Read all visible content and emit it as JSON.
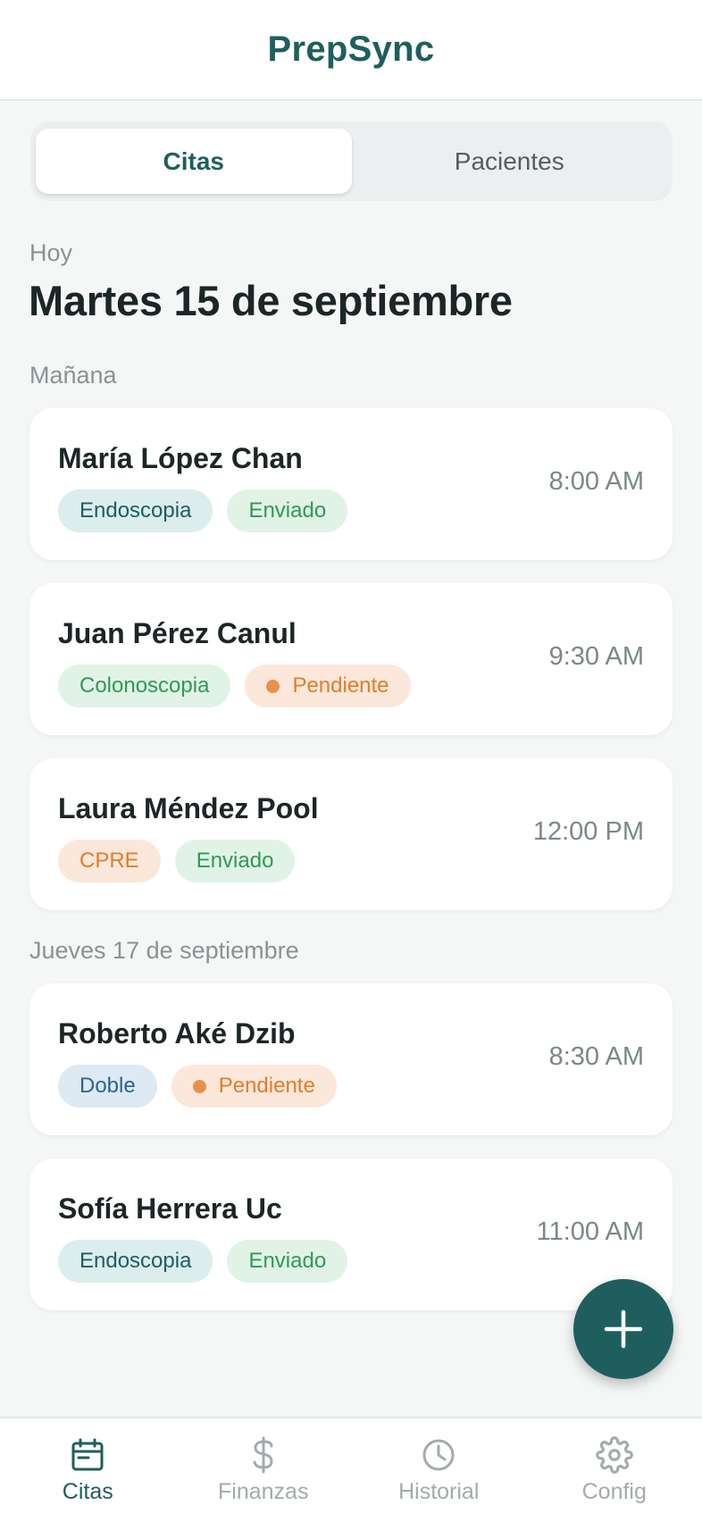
{
  "header": {
    "title": "PrepSync"
  },
  "tabs": [
    {
      "label": "Citas",
      "active": true
    },
    {
      "label": "Pacientes",
      "active": false
    }
  ],
  "today": {
    "label": "Hoy",
    "date": "Martes 15 de septiembre"
  },
  "sections": [
    {
      "label": "Mañana"
    },
    {
      "label": "Jueves 17 de septiembre"
    }
  ],
  "appointments": [
    {
      "name": "María López Chan",
      "time": "8:00 AM",
      "procedure": "Endoscopia",
      "status": "Enviado"
    },
    {
      "name": "Juan Pérez Canul",
      "time": "9:30 AM",
      "procedure": "Colonoscopia",
      "status": "Pendiente"
    },
    {
      "name": "Laura Méndez Pool",
      "time": "12:00 PM",
      "procedure": "CPRE",
      "status": "Enviado"
    },
    {
      "name": "Roberto Aké Dzib",
      "time": "8:30 AM",
      "procedure": "Doble",
      "status": "Pendiente"
    },
    {
      "name": "Sofía Herrera Uc",
      "time": "11:00 AM",
      "procedure": "Endoscopia",
      "status": "Enviado"
    }
  ],
  "badge_colors": {
    "Endoscopia": {
      "bg": "#dcedee",
      "fg": "#1e5f5d"
    },
    "Colonoscopia": {
      "bg": "#e1f3e7",
      "fg": "#2e9a55"
    },
    "CPRE": {
      "bg": "#fce8da",
      "fg": "#e37b2c"
    },
    "Doble": {
      "bg": "#dde9f3",
      "fg": "#2e6390"
    },
    "Enviado": {
      "bg": "#e1f3e7",
      "fg": "#2e9a55"
    },
    "Pendiente": {
      "bg": "#fce8da",
      "fg": "#e37b2c",
      "dot": "#e8914a"
    }
  },
  "fab": {
    "icon": "plus-icon",
    "color": "#1e5f5d"
  },
  "nav": [
    {
      "label": "Citas",
      "icon": "calendar-icon",
      "active": true
    },
    {
      "label": "Finanzas",
      "icon": "dollar-icon",
      "active": false
    },
    {
      "label": "Historial",
      "icon": "clock-icon",
      "active": false
    },
    {
      "label": "Config",
      "icon": "gear-icon",
      "active": false
    }
  ],
  "colors": {
    "accent": "#1e5f5d",
    "background": "#f5f7f7",
    "nav_inactive": "#a3abac"
  }
}
